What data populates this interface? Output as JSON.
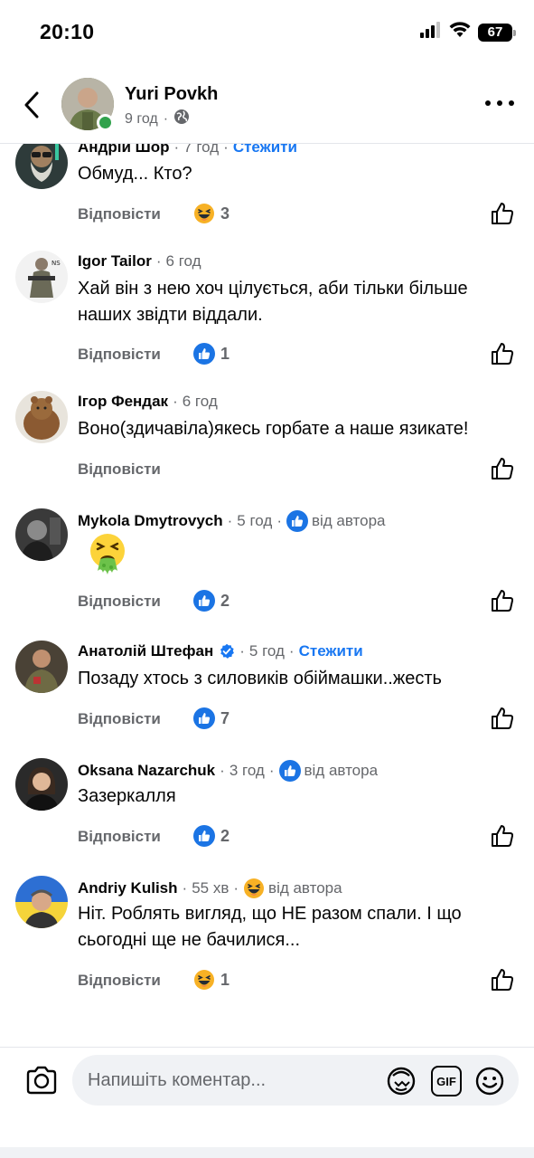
{
  "status_bar": {
    "time": "20:10",
    "battery": "67",
    "icons": [
      "signal-icon",
      "wifi-icon",
      "battery-icon"
    ]
  },
  "header": {
    "author_name": "Yuri Povkh",
    "time": "9 год",
    "separator": "·",
    "icons": [
      "back-arrow-icon",
      "globe-icon",
      "more-icon"
    ]
  },
  "comments": [
    {
      "name": "Андрій Шор",
      "time": "7 год",
      "follow": "Стежити",
      "text": "Обмуд... Кто?",
      "reply": "Відповісти",
      "reaction": "haha",
      "count": "3"
    },
    {
      "name": "Igor Tailor",
      "time": "6 год",
      "text": "Хай він з нею хоч цілується, аби тільки більше наших звідти віддали.",
      "reply": "Відповісти",
      "reaction": "like",
      "count": "1"
    },
    {
      "name": "Ігор Фендак",
      "time": "6 год",
      "text": "Воно(здичавіла)якесь горбате а наше язикате!",
      "reply": "Відповісти"
    },
    {
      "name": "Mykola Dmytrovych",
      "time": "5 год",
      "author_badge": "від автора",
      "author_reaction": "like",
      "text": "🤮",
      "reply": "Відповісти",
      "reaction": "like",
      "count": "2"
    },
    {
      "name": "Анатолій Штефан",
      "verified": true,
      "time": "5 год",
      "follow": "Стежити",
      "text": "Позаду хтось з силовиків обіймашки..жесть",
      "reply": "Відповісти",
      "reaction": "like",
      "count": "7"
    },
    {
      "name": "Oksana Nazarchuk",
      "time": "3 год",
      "author_badge": "від автора",
      "author_reaction": "like",
      "text": "Зазеркалля",
      "reply": "Відповісти",
      "reaction": "like",
      "count": "2"
    },
    {
      "name": "Andriy Kulish",
      "time": "55 хв",
      "author_badge": "від автора",
      "author_reaction": "haha",
      "text": "Ніт. Роблять вигляд, що НЕ разом спали. І що сьогодні ще не бачилися...",
      "reply": "Відповісти",
      "reaction": "haha",
      "count": "1"
    }
  ],
  "composer": {
    "placeholder": "Напишіть коментар...",
    "gif_label": "GIF",
    "icons": [
      "camera-icon",
      "avatar-sticker-icon",
      "gif-icon",
      "emoji-icon"
    ]
  },
  "colors": {
    "accent": "#1877f2",
    "text": "#050505",
    "secondary": "#65676b",
    "input_bg": "#f0f2f5"
  }
}
